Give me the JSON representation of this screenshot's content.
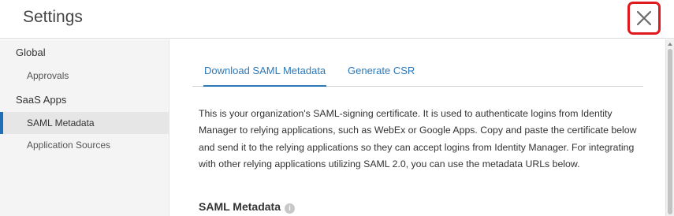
{
  "header": {
    "title": "Settings",
    "close_icon": "close-icon"
  },
  "sidebar": {
    "groups": [
      {
        "label": "Global",
        "items": [
          {
            "label": "Approvals",
            "active": false
          }
        ]
      },
      {
        "label": "SaaS Apps",
        "items": [
          {
            "label": "SAML Metadata",
            "active": true
          },
          {
            "label": "Application Sources",
            "active": false
          }
        ]
      }
    ]
  },
  "main": {
    "tabs": [
      {
        "label": "Download SAML Metadata",
        "active": true
      },
      {
        "label": "Generate CSR",
        "active": false
      }
    ],
    "description": "This is your organization's SAML-signing certificate. It is used to authenticate logins from Identity Manager to relying applications, such as WebEx or Google Apps. Copy and paste the certificate below and send it to the relying applications so they can accept logins from Identity Manager. For integrating with other relying applications utilizing SAML 2.0, you can use the metadata URLs below.",
    "section_title": "SAML Metadata",
    "section_info_icon": "info-icon"
  },
  "colors": {
    "accent": "#2e78b8",
    "highlight": "#e0191f",
    "sidebar_bg": "#f4f4f4"
  }
}
